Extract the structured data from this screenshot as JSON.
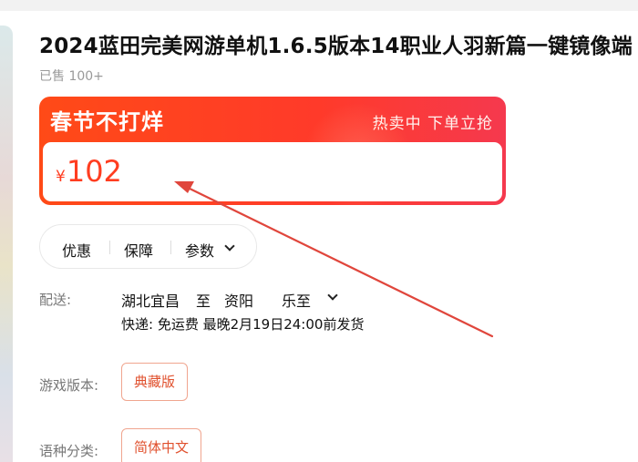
{
  "product": {
    "title": "2024蓝田完美网游单机1.6.5版本14职业人羽新篇一键镜像端",
    "sold": "已售 100+"
  },
  "promo": {
    "title": "春节不打烊",
    "tagline": "热卖中 下单立抢",
    "currency": "¥",
    "price": "102"
  },
  "info_tabs": {
    "discount": "优惠",
    "guarantee": "保障",
    "params": "参数"
  },
  "shipping": {
    "label": "配送:",
    "origin": "湖北宜昌",
    "to": "至",
    "destination": "资阳",
    "district": "乐至",
    "detail": "快递: 免运费  最晚2月19日24:00前发货"
  },
  "options": [
    {
      "label": "游戏版本:",
      "value": "典藏版"
    },
    {
      "label": "语种分类:",
      "value": "简体中文"
    }
  ],
  "colors": {
    "accent": "#ff3d20",
    "promo_start": "#ff4a17",
    "promo_end": "#f5394e",
    "annotation_arrow": "#e0463c"
  },
  "icons": {
    "params_toggle": "chevron-down-icon",
    "district_toggle": "chevron-down-icon"
  }
}
